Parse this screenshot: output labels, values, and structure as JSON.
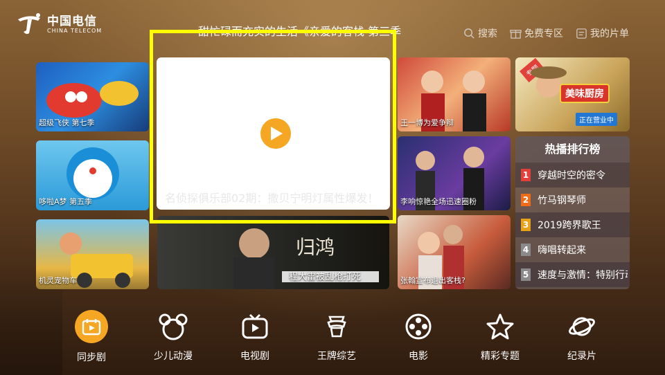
{
  "header": {
    "logo_cn": "中国电信",
    "logo_en": "CHINA TELECOM",
    "marquee": "甜忙碌而充实的生活《亲爱的客栈 第三季",
    "nav": [
      {
        "label": "搜索",
        "icon": "search-icon"
      },
      {
        "label": "免费专区",
        "icon": "gift-icon"
      },
      {
        "label": "我的片单",
        "icon": "playlist-icon"
      }
    ]
  },
  "tiles": {
    "t1": "超级飞侠 第七季",
    "t2": "哆啦A梦 第五季",
    "t3": "机灵宠物车",
    "t4": "程大雷被乱枪打死",
    "t5": "王一博为爱争辩",
    "t6": "李响惊艳全场迅速圈粉",
    "t7": "张翰宣布退出客栈?",
    "t8_badge": "专题",
    "t8_title": "美味厨房",
    "t8_tag": "正在营业中"
  },
  "player": {
    "title": "名侦探俱乐部02期：撒贝宁明灯属性爆发！"
  },
  "ranking": {
    "title": "热播排行榜",
    "items": [
      {
        "num": "1",
        "name": "穿越时空的密令",
        "color": "#e2403a"
      },
      {
        "num": "2",
        "name": "竹马钢琴师",
        "color": "#ef6c1a"
      },
      {
        "num": "3",
        "name": "2019跨界歌王",
        "color": "#e8a21a"
      },
      {
        "num": "4",
        "name": "嗨唱转起来",
        "color": "#8a8a8a"
      },
      {
        "num": "5",
        "name": "速度与激情：特别行动",
        "color": "#8a8a8a"
      }
    ]
  },
  "bottom_nav": [
    {
      "label": "同步剧",
      "icon": "sync-drama-icon"
    },
    {
      "label": "少儿动漫",
      "icon": "kids-icon"
    },
    {
      "label": "电视剧",
      "icon": "tv-icon"
    },
    {
      "label": "王牌综艺",
      "icon": "variety-icon"
    },
    {
      "label": "电影",
      "icon": "film-reel-icon"
    },
    {
      "label": "精彩专题",
      "icon": "star-icon"
    },
    {
      "label": "纪录片",
      "icon": "planet-icon"
    }
  ],
  "colors": {
    "focus": "#ffff00",
    "accent": "#f5a623"
  }
}
